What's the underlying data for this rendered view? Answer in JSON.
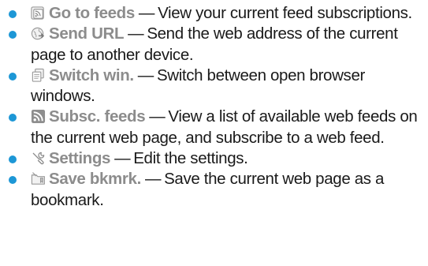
{
  "items": [
    {
      "icon": "feeds-icon",
      "name": "Go to feeds",
      "desc": "View your current feed subscriptions."
    },
    {
      "icon": "send-url-icon",
      "name": "Send URL",
      "desc": "Send the web address of the current page to another device."
    },
    {
      "icon": "switch-window-icon",
      "name": "Switch win.",
      "desc": "Switch between open browser windows."
    },
    {
      "icon": "subscribe-feeds-icon",
      "name": "Subsc. feeds",
      "desc": "View a list of available web feeds on the current web page, and subscribe to a web feed."
    },
    {
      "icon": "settings-icon",
      "name": "Settings",
      "desc": "Edit the settings."
    },
    {
      "icon": "save-bookmark-icon",
      "name": "Save bkmrk.",
      "desc": "Save the current web page as a bookmark."
    }
  ],
  "separator": "—",
  "colors": {
    "bullet": "#1d97d6",
    "option_name": "#8c8c8c",
    "text": "#1a1a1a"
  }
}
